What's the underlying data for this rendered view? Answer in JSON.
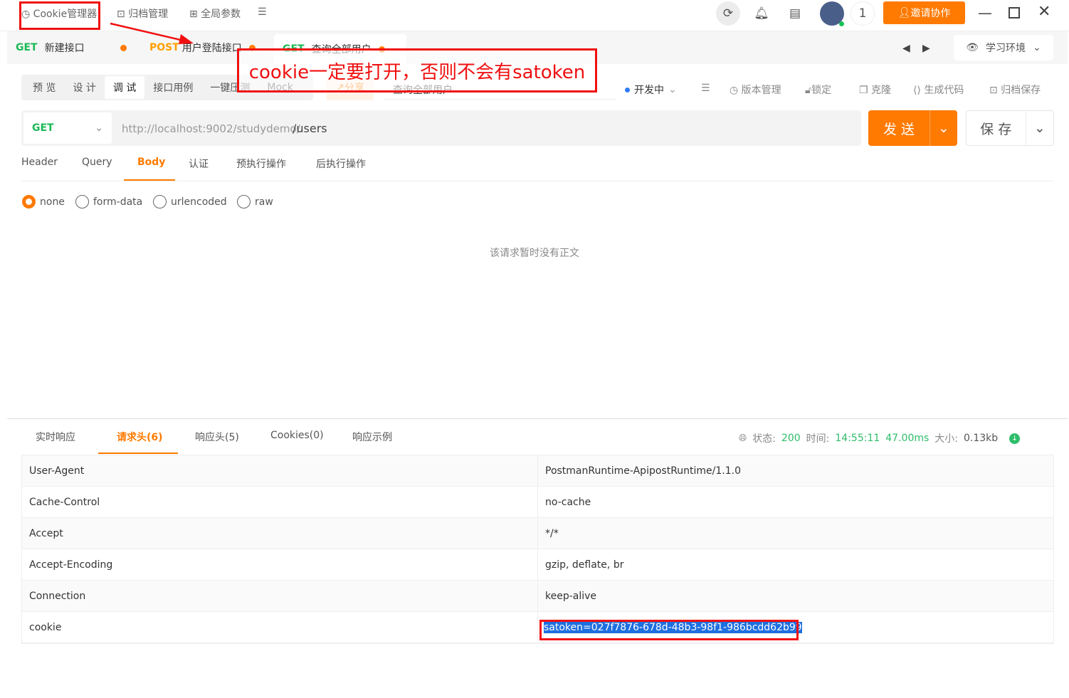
{
  "topbar": {
    "cookie_manager": "Cookie管理器",
    "archive": "归档管理",
    "global_params": "全局参数",
    "notification_count": "1",
    "invite": "邀请协作"
  },
  "tabs": [
    {
      "method": "GET",
      "name": "新建接口"
    },
    {
      "method": "POST",
      "name": "用户登陆接口"
    },
    {
      "method": "GET",
      "name": "查询全部用户"
    }
  ],
  "env": "学习环境",
  "subtabs": [
    "预 览",
    "设 计",
    "调 试",
    "接口用例",
    "一键压测",
    "Mock"
  ],
  "share": "分享",
  "api_name": "查询全部用户",
  "status_select": "开发中",
  "tools": [
    "版本管理",
    "锁定",
    "克隆",
    "生成代码",
    "归档保存"
  ],
  "request": {
    "method": "GET",
    "base_url": "http://localhost:9002/studydemo/",
    "path": "/users",
    "send": "发 送",
    "save": "保 存"
  },
  "req_tabs": [
    "Header",
    "Query",
    "Body",
    "认证",
    "预执行操作",
    "后执行操作"
  ],
  "body_types": [
    "none",
    "form-data",
    "urlencoded",
    "raw"
  ],
  "empty_body": "该请求暂时没有正文",
  "resp_tabs": [
    "实时响应",
    "请求头(6)",
    "响应头(5)",
    "Cookies(0)",
    "响应示例"
  ],
  "resp_status": {
    "status_label": "状态:",
    "status": "200",
    "time_label": "时间:",
    "time": "14:55:11",
    "duration": "47.00ms",
    "size_label": "大小:",
    "size": "0.13kb"
  },
  "headers": [
    {
      "k": "User-Agent",
      "v": "PostmanRuntime-ApipostRuntime/1.1.0"
    },
    {
      "k": "Cache-Control",
      "v": "no-cache"
    },
    {
      "k": "Accept",
      "v": "*/*"
    },
    {
      "k": "Accept-Encoding",
      "v": "gzip, deflate, br"
    },
    {
      "k": "Connection",
      "v": "keep-alive"
    },
    {
      "k": "cookie",
      "v": "satoken=027f7876-678d-48b3-98f1-986bcdd62b99"
    }
  ],
  "annotation": "cookie一定要打开，否则不会有satoken",
  "colors": {
    "accent": "#ff7a00",
    "get": "#19b955",
    "post": "#ff9f00",
    "annotation": "#f01010"
  }
}
